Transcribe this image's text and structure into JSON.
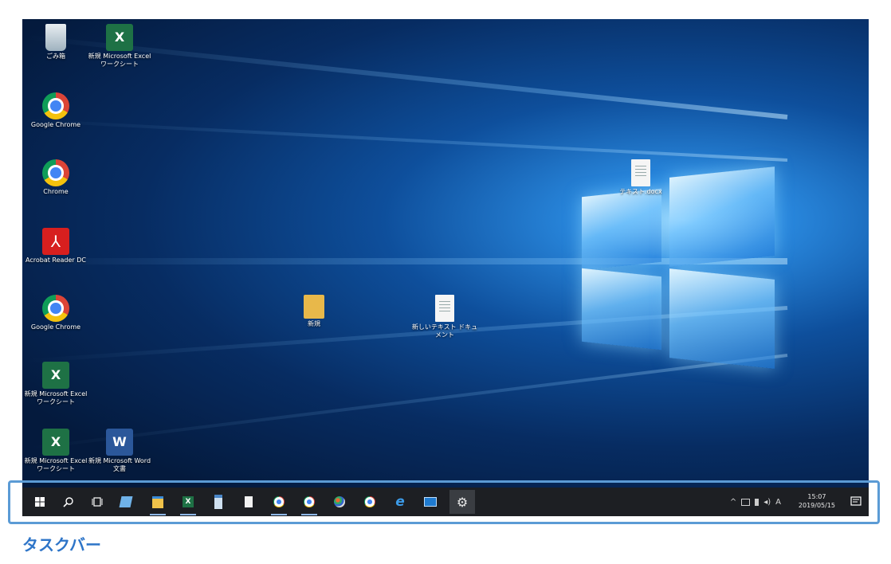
{
  "desktop": {
    "icons": [
      {
        "label": "ごみ箱",
        "icon": "recycle-bin-icon"
      },
      {
        "label": "新規 Microsoft Excel ワークシート",
        "icon": "excel-icon"
      },
      {
        "label": "Google Chrome",
        "icon": "chrome-icon"
      },
      {
        "label": "Chrome",
        "icon": "chrome-icon"
      },
      {
        "label": "Acrobat Reader DC",
        "icon": "pdf-icon"
      },
      {
        "label": "Google Chrome",
        "icon": "chrome-icon"
      },
      {
        "label": "新規 Microsoft Excel ワークシート",
        "icon": "excel-icon"
      },
      {
        "label": "新規 Microsoft Excel ワークシート",
        "icon": "excel-icon"
      },
      {
        "label": "新規 Microsoft Word 文書",
        "icon": "word-icon"
      },
      {
        "label": "新規",
        "icon": "folder-icon"
      },
      {
        "label": "新しいテキスト ドキュメント",
        "icon": "text-document-icon"
      },
      {
        "label": "テキスト.docx",
        "icon": "text-document-icon"
      }
    ]
  },
  "taskbar": {
    "items": [
      {
        "name": "start-button",
        "icon": "windows-logo-icon"
      },
      {
        "name": "search-button",
        "icon": "search-icon"
      },
      {
        "name": "task-view-button",
        "icon": "task-view-icon"
      },
      {
        "name": "notes-button",
        "icon": "notes-icon"
      },
      {
        "name": "file-explorer-button",
        "icon": "folder-icon"
      },
      {
        "name": "excel-button",
        "icon": "excel-icon"
      },
      {
        "name": "calculator-button",
        "icon": "calculator-icon"
      },
      {
        "name": "document-button",
        "icon": "document-icon"
      },
      {
        "name": "chrome-button-1",
        "icon": "chrome-icon"
      },
      {
        "name": "chrome-button-2",
        "icon": "chrome-icon"
      },
      {
        "name": "paint-button",
        "icon": "paint-icon"
      },
      {
        "name": "chrome-button-3",
        "icon": "chrome-icon"
      },
      {
        "name": "edge-button",
        "icon": "edge-icon"
      },
      {
        "name": "mail-button",
        "icon": "mail-icon"
      },
      {
        "name": "settings-button",
        "icon": "gear-icon"
      }
    ],
    "tray": {
      "chevron": "^",
      "ime": "A",
      "time": "15:07",
      "date": "2019/05/15"
    }
  },
  "caption": "タスクバー",
  "colors": {
    "highlight": "#5b9bd5",
    "caption": "#2e75c8",
    "taskbar": "#1d1f23"
  }
}
